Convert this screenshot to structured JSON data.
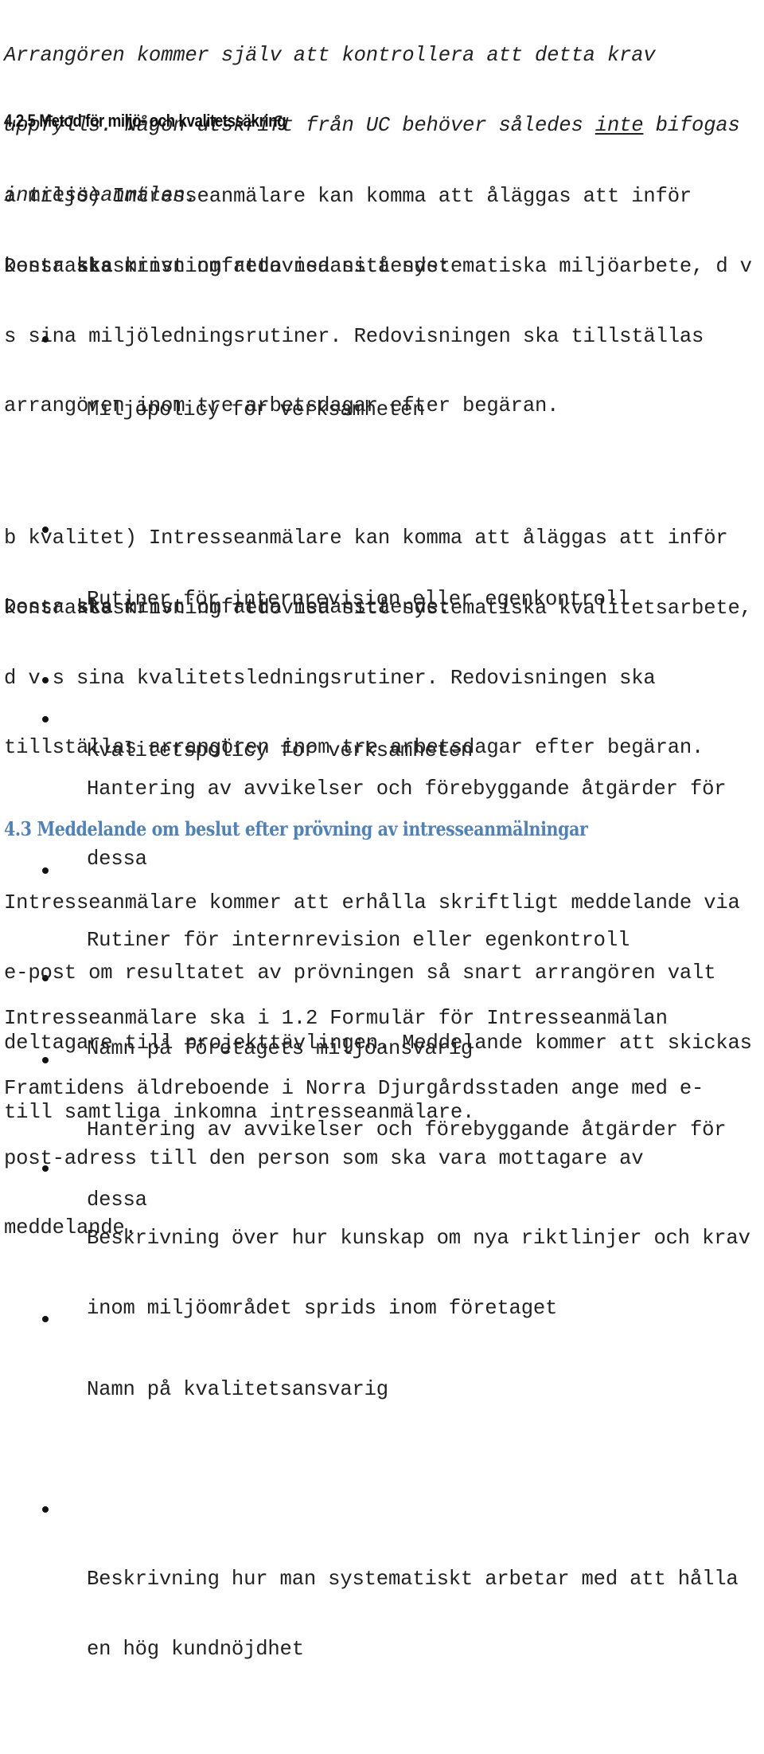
{
  "intro": {
    "lines": [
      "Arrangören kommer själv att kontrollera att detta krav",
      "uppfylls. Någon utskrift från UC behöver således ",
      "intresseanmälan."
    ],
    "underlined_word": "inte",
    "line2_tail": " bifogas"
  },
  "section_425": {
    "heading": "4.2.5 Metod för miljö- och kvalitetssäkring",
    "part_a": {
      "lines": [
        "a miljö) Intresseanmälare kan komma att åläggas att inför",
        "kontraktsskrivning redovisa sitt systematiska miljöarbete, d v",
        "s sina miljöledningsrutiner. Redovisningen ska tillställas",
        "arrangören inom tre arbetsdagar efter begäran."
      ],
      "list_intro": {
        "before": "Dessa ",
        "bold": "ska",
        "after": " minst omfatta nedanstående:"
      },
      "items": [
        [
          "Miljöpolicy för verksamheten"
        ],
        [
          "Rutiner för internrevision eller egenkontroll"
        ],
        [
          "Hantering av avvikelser och förebyggande åtgärder för",
          "dessa"
        ],
        [
          "Namn på företagets miljöansvarig"
        ],
        [
          "Beskrivning över hur kunskap om nya riktlinjer och krav",
          "inom miljöområdet sprids inom företaget"
        ]
      ]
    },
    "part_b": {
      "lines": [
        "b kvalitet) Intresseanmälare kan komma att åläggas att inför",
        "kontraktsskrivning redovisa sitt systematiska kvalitetsarbete,",
        "d v s sina kvalitetsledningsrutiner. Redovisningen ska",
        "tillställas arrangören inom tre arbetsdagar efter begäran."
      ],
      "list_intro": {
        "before": "Dessa ",
        "bold": "ska",
        "after": " minst omfatta nedanstående:"
      },
      "items": [
        [
          "Kvalitetspolicy för verksamheten"
        ],
        [
          "Rutiner för internrevision eller egenkontroll"
        ],
        [
          "Hantering av avvikelser och förebyggande åtgärder för",
          "dessa"
        ],
        [
          "Namn på kvalitetsansvarig"
        ],
        [
          "Beskrivning hur man systematiskt arbetar med att hålla",
          "en hög kundnöjdhet"
        ]
      ]
    }
  },
  "section_43": {
    "heading": "4.3 Meddelande om beslut efter prövning av intresseanmälningar",
    "heading_color": "#4f81bd",
    "para1": [
      "Intresseanmälare kommer att erhålla skriftligt meddelande via",
      "e-post om resultatet av prövningen så snart arrangören valt",
      "deltagare till projekttävlingen. Meddelande kommer att skickas",
      "till samtliga inkomna intresseanmälare."
    ],
    "para2": [
      "Intresseanmälare ska i 1.2 Formulär för Intresseanmälan",
      "Framtidens äldreboende i Norra Djurgårdsstaden ange med e-",
      "post-adress till den person som ska vara mottagare av",
      "meddelande."
    ]
  }
}
